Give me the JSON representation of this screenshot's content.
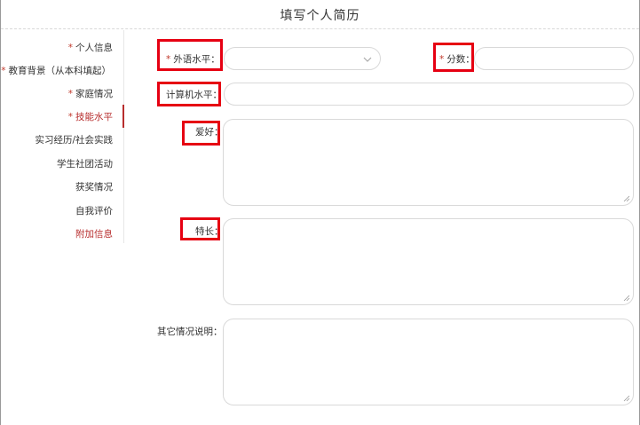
{
  "header": {
    "title": "填写个人简历"
  },
  "sidebar": {
    "items": [
      {
        "label": "个人信息",
        "required": "*"
      },
      {
        "label": "教育背景（从本科填起）",
        "required": "*"
      },
      {
        "label": "家庭情况",
        "required": "*"
      },
      {
        "label": "技能水平",
        "required": "*"
      },
      {
        "label": "实习经历/社会实践"
      },
      {
        "label": "学生社团活动"
      },
      {
        "label": "获奖情况"
      },
      {
        "label": "自我评价"
      },
      {
        "label": "附加信息"
      }
    ]
  },
  "form": {
    "foreign_language": {
      "required": "*",
      "label": "外语水平：",
      "value": ""
    },
    "score": {
      "required": "*",
      "label": "分数：",
      "value": ""
    },
    "computer_level": {
      "label": "计算机水平：",
      "value": ""
    },
    "hobbies": {
      "label": "爱好：",
      "value": ""
    },
    "specialty": {
      "label": "特长：",
      "value": ""
    },
    "other_notes": {
      "label": "其它情况说明：",
      "value": ""
    }
  },
  "colors": {
    "accent": "#b72d2d",
    "highlight": "#e60012",
    "border": "#d9d9d9"
  },
  "icons": {
    "select_arrow": "chevron-down-icon",
    "resize_handle": "resize-grip-icon"
  }
}
